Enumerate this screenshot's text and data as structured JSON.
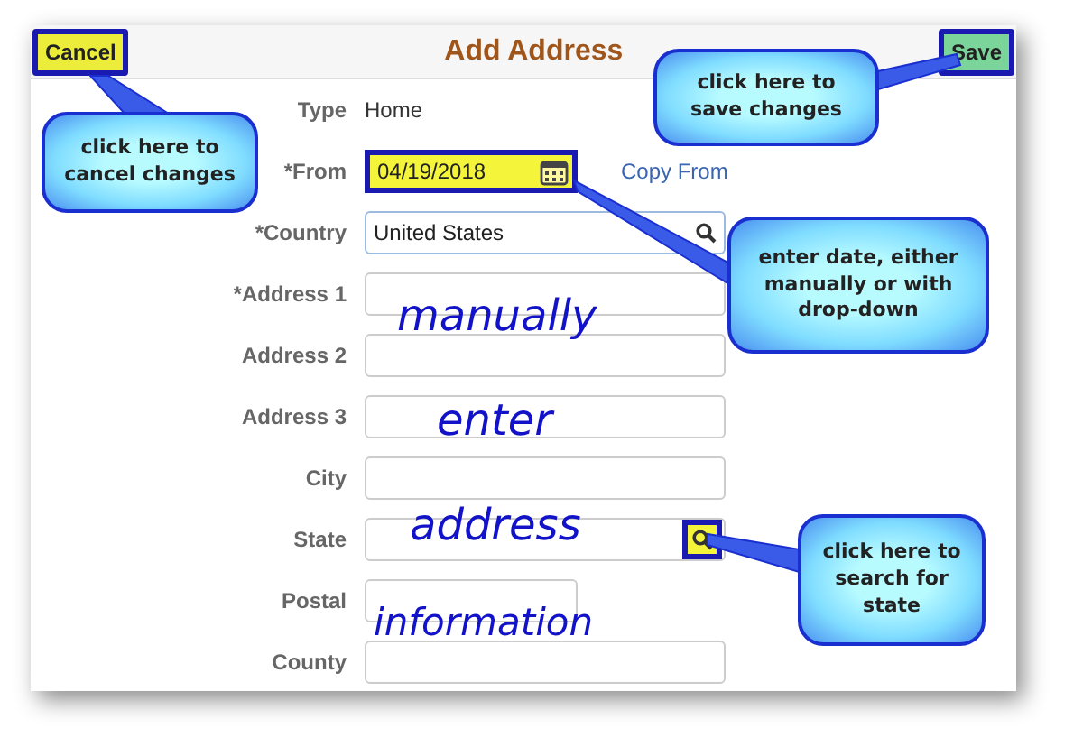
{
  "header": {
    "title": "Add Address",
    "cancel": {
      "label": "Cancel",
      "highlighted": true
    },
    "save": {
      "label": "Save",
      "highlighted": true
    }
  },
  "fields": [
    {
      "label": "Type",
      "kind": "text",
      "value": "Home"
    },
    {
      "label": "*From",
      "kind": "date",
      "value": "04/19/2018",
      "highlighted": true,
      "link": "Copy From"
    },
    {
      "label": "*Country",
      "kind": "lookup",
      "value": "United States"
    },
    {
      "label": "*Address 1",
      "kind": "input"
    },
    {
      "label": "Address 2",
      "kind": "input"
    },
    {
      "label": "Address 3",
      "kind": "input"
    },
    {
      "label": "City",
      "kind": "input"
    },
    {
      "label": "State",
      "kind": "lookup-button",
      "highlighted": true
    },
    {
      "label": "Postal",
      "kind": "short"
    },
    {
      "label": "County",
      "kind": "input"
    }
  ],
  "annotations": {
    "callouts": [
      "click here to cancel changes",
      "click here to save changes",
      "enter date, either manually or with drop-down",
      "click here to search for state"
    ],
    "overlay_words": [
      "manually",
      "enter",
      "address",
      "information"
    ]
  }
}
